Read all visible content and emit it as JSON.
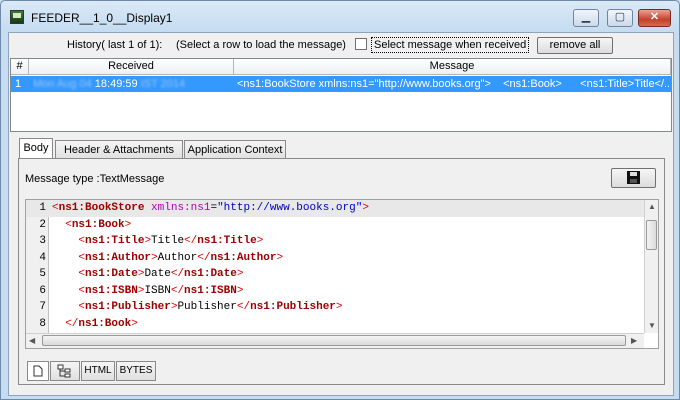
{
  "window": {
    "title": "FEEDER__1_0__Display1",
    "min": "▁",
    "max": "▢",
    "close": "✕"
  },
  "history": {
    "label": "History( last 1 of 1):",
    "hint": "(Select a row to load the message)",
    "checkbox_label": "Select message when received",
    "remove_label": "remove all",
    "columns": [
      "#",
      "Received",
      "Message"
    ],
    "rows": [
      {
        "num": "1",
        "received_blur_a": "Mon Aug 04",
        "received_time": "18:49:59",
        "received_blur_b": "IST 2014",
        "message": "<ns1:BookStore xmlns:ns1=\"http://www.books.org\">    <ns1:Book>      <ns1:Title>Title</..."
      }
    ]
  },
  "tabs": [
    "Body",
    "Header & Attachments",
    "Application Context"
  ],
  "body": {
    "message_type": "Message type :TextMessage",
    "lines": [
      {
        "n": "1",
        "indent": "",
        "open": "ns1:BookStore",
        "attr": "xmlns:ns1",
        "val": "\"http://www.books.org\"",
        "text": "",
        "close": ""
      },
      {
        "n": "2",
        "indent": "  ",
        "open": "ns1:Book",
        "attr": "",
        "val": "",
        "text": "",
        "close": ""
      },
      {
        "n": "3",
        "indent": "    ",
        "open": "ns1:Title",
        "attr": "",
        "val": "",
        "text": "Title",
        "close": "ns1:Title"
      },
      {
        "n": "4",
        "indent": "    ",
        "open": "ns1:Author",
        "attr": "",
        "val": "",
        "text": "Author",
        "close": "ns1:Author"
      },
      {
        "n": "5",
        "indent": "    ",
        "open": "ns1:Date",
        "attr": "",
        "val": "",
        "text": "Date",
        "close": "ns1:Date"
      },
      {
        "n": "6",
        "indent": "    ",
        "open": "ns1:ISBN",
        "attr": "",
        "val": "",
        "text": "ISBN",
        "close": "ns1:ISBN"
      },
      {
        "n": "7",
        "indent": "    ",
        "open": "ns1:Publisher",
        "attr": "",
        "val": "",
        "text": "Publisher",
        "close": "ns1:Publisher"
      },
      {
        "n": "8",
        "indent": "  ",
        "open": "",
        "attr": "",
        "val": "",
        "text": "",
        "close": "ns1:Book"
      }
    ],
    "view_tabs": [
      "page-icon",
      "tree-icon",
      "HTML",
      "BYTES"
    ]
  }
}
